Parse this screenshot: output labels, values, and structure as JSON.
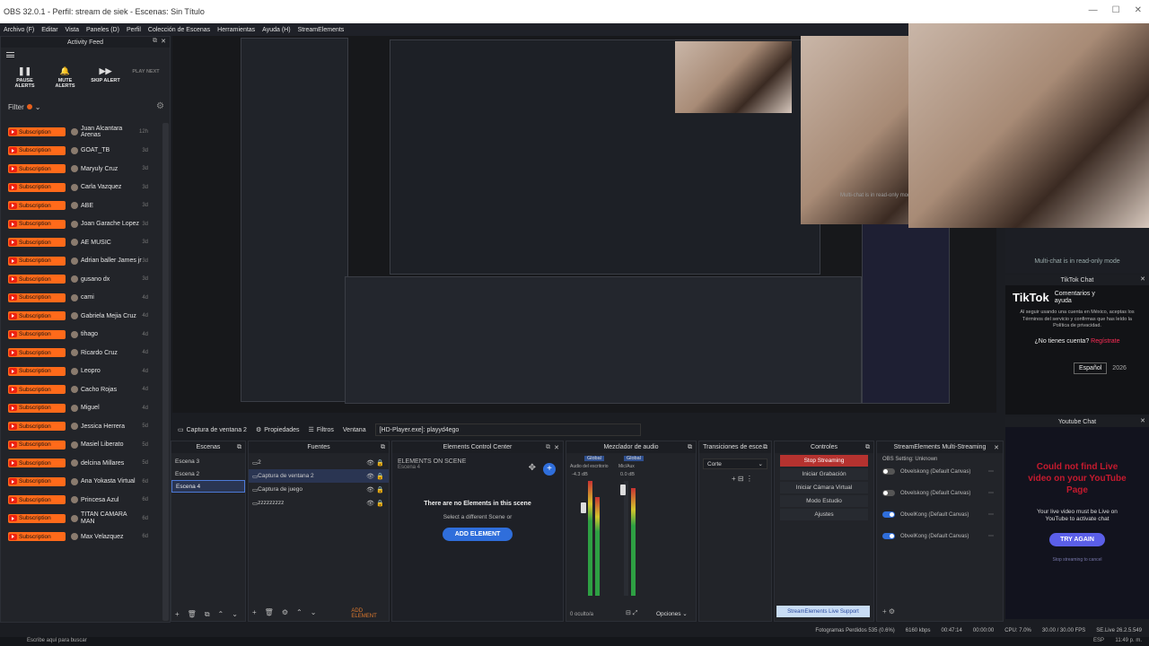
{
  "window": {
    "title": "OBS 32.0.1 - Perfil: stream de siek - Escenas: Sin Título"
  },
  "menu": [
    "Archivo (F)",
    "Editar",
    "Vista",
    "Paneles (D)",
    "Perfil",
    "Colección de Escenas",
    "Herramientas",
    "Ayuda (H)",
    "StreamElements"
  ],
  "activity": {
    "title": "Activity Feed",
    "controls": [
      {
        "icon": "❚❚",
        "label": "PAUSE ALERTS"
      },
      {
        "icon": "🔔",
        "label": "MUTE ALERTS"
      },
      {
        "icon": "▶▶",
        "label": "SKIP ALERT"
      },
      {
        "icon": "",
        "label": "PLAY NEXT"
      }
    ],
    "filter_label": "Filter",
    "badge": "Subscription",
    "rows": [
      {
        "name": "Juan Alcantara Arenas",
        "ago": "12h"
      },
      {
        "name": "GOAT_TB",
        "ago": "3d"
      },
      {
        "name": "Maryuly Cruz",
        "ago": "3d"
      },
      {
        "name": "Carla Vazquez",
        "ago": "3d"
      },
      {
        "name": "ABE",
        "ago": "3d"
      },
      {
        "name": "Joan Garache Lopez",
        "ago": "3d"
      },
      {
        "name": "AE MUSIC",
        "ago": "3d"
      },
      {
        "name": "Adrian baller James jr",
        "ago": "3d"
      },
      {
        "name": "gusano dx",
        "ago": "3d"
      },
      {
        "name": "cami",
        "ago": "4d"
      },
      {
        "name": "Gabriela Mejia Cruz",
        "ago": "4d"
      },
      {
        "name": "tihago",
        "ago": "4d"
      },
      {
        "name": "Ricardo Cruz",
        "ago": "4d"
      },
      {
        "name": "Leopro",
        "ago": "4d"
      },
      {
        "name": "Cacho Rojas",
        "ago": "4d"
      },
      {
        "name": "Miguel",
        "ago": "4d"
      },
      {
        "name": "Jessica Herrera",
        "ago": "5d"
      },
      {
        "name": "Masiel Liberato",
        "ago": "5d"
      },
      {
        "name": "delcina Millares",
        "ago": "5d"
      },
      {
        "name": "Ana Yokasta Virtual",
        "ago": "6d"
      },
      {
        "name": "Princesa Azul",
        "ago": "6d"
      },
      {
        "name": "TITAN CAMARA MAN",
        "ago": "6d"
      },
      {
        "name": "Max Velazquez",
        "ago": "6d"
      }
    ]
  },
  "preview_overlay": {
    "multichat_text": "Multi-chat is in read-only mode",
    "tiktok_chat": "TikTok Chat",
    "tiktok_logo": "TikTok",
    "tiktok_help": "Comentarios y ayuda",
    "tiktok_terms": "Al seguir usando una cuenta en México, aceptas los Términos del servicio y confirmas que has leído la Política de privacidad.",
    "no_account": "¿No tienes cuenta?",
    "register": "Regístrate",
    "language": "Español",
    "year": "2026",
    "youtube_chat": "Youtube Chat",
    "yt_error": "Could not find Live video on your YouTube Page",
    "yt_hint": "Your live video must be Live on YouTube to activate chat",
    "try_again": "TRY AGAIN",
    "yt_footer": "Stop streaming to cancel"
  },
  "scenebar": {
    "source": "Captura de ventana 2",
    "props": "Propiedades",
    "filters": "Filtros",
    "window_label": "Ventana",
    "window_value": "[HD-Player.exe]: playyd4ego"
  },
  "scenes": {
    "title": "Escenas",
    "items": [
      "Escena 3",
      "Escena 2",
      "Escena 4"
    ],
    "selected": 2
  },
  "sources": {
    "title": "Fuentes",
    "items": [
      "2",
      "Captura de ventana 2",
      "Captura de juego",
      "zzzzzzzzz"
    ],
    "selected": 1
  },
  "ecc": {
    "title": "Elements Control Center",
    "heading": "ELEMENTS ON SCENE",
    "sub": "Escena 4",
    "empty": "There are no Elements in this scene",
    "select": "Select a different Scene or",
    "add": "ADD ELEMENT"
  },
  "mixer": {
    "title": "Mezclador de audio",
    "ch1": "Global",
    "ch2": "Global",
    "sub1": "Audio del escritorio",
    "sub2": "Mic/Aux",
    "db1": "-4.3 dB",
    "db2": "0.0 dB",
    "hidden": "0 oculto/a",
    "options": "Opciones"
  },
  "transitions": {
    "title": "Transiciones de esce...",
    "value": "Corte"
  },
  "controls": {
    "title": "Controles",
    "stop": "Stop Streaming",
    "record": "Iniciar Grabación",
    "vcam": "Iniciar Cámara Virtual",
    "studio": "Modo Estudio",
    "settings": "Ajustes",
    "support": "StreamElements Live Support"
  },
  "se_multi": {
    "title": "StreamElements Multi-Streaming",
    "status": "OBS Setting: Unknown",
    "canvas": [
      "Obvelskong (Default Canvas)",
      "Obvelskong (Default Canvas)",
      "ObvelKong (Default Canvas)",
      "ObvelKong (Default Canvas)"
    ]
  },
  "status": {
    "frames": "Fotogramas Perdidos 535 (0.6%)",
    "kbps": "6160 kbps",
    "live": "00:47:14",
    "rec": "00:00:00",
    "cpu": "CPU: 7.0%",
    "fps": "30.00 / 30.00 FPS",
    "se": "SE.Live 26.2.5.549"
  },
  "taskbar": {
    "search": "Escribe aquí para buscar",
    "time": "11:49 p. m.",
    "lang": "ESP"
  }
}
